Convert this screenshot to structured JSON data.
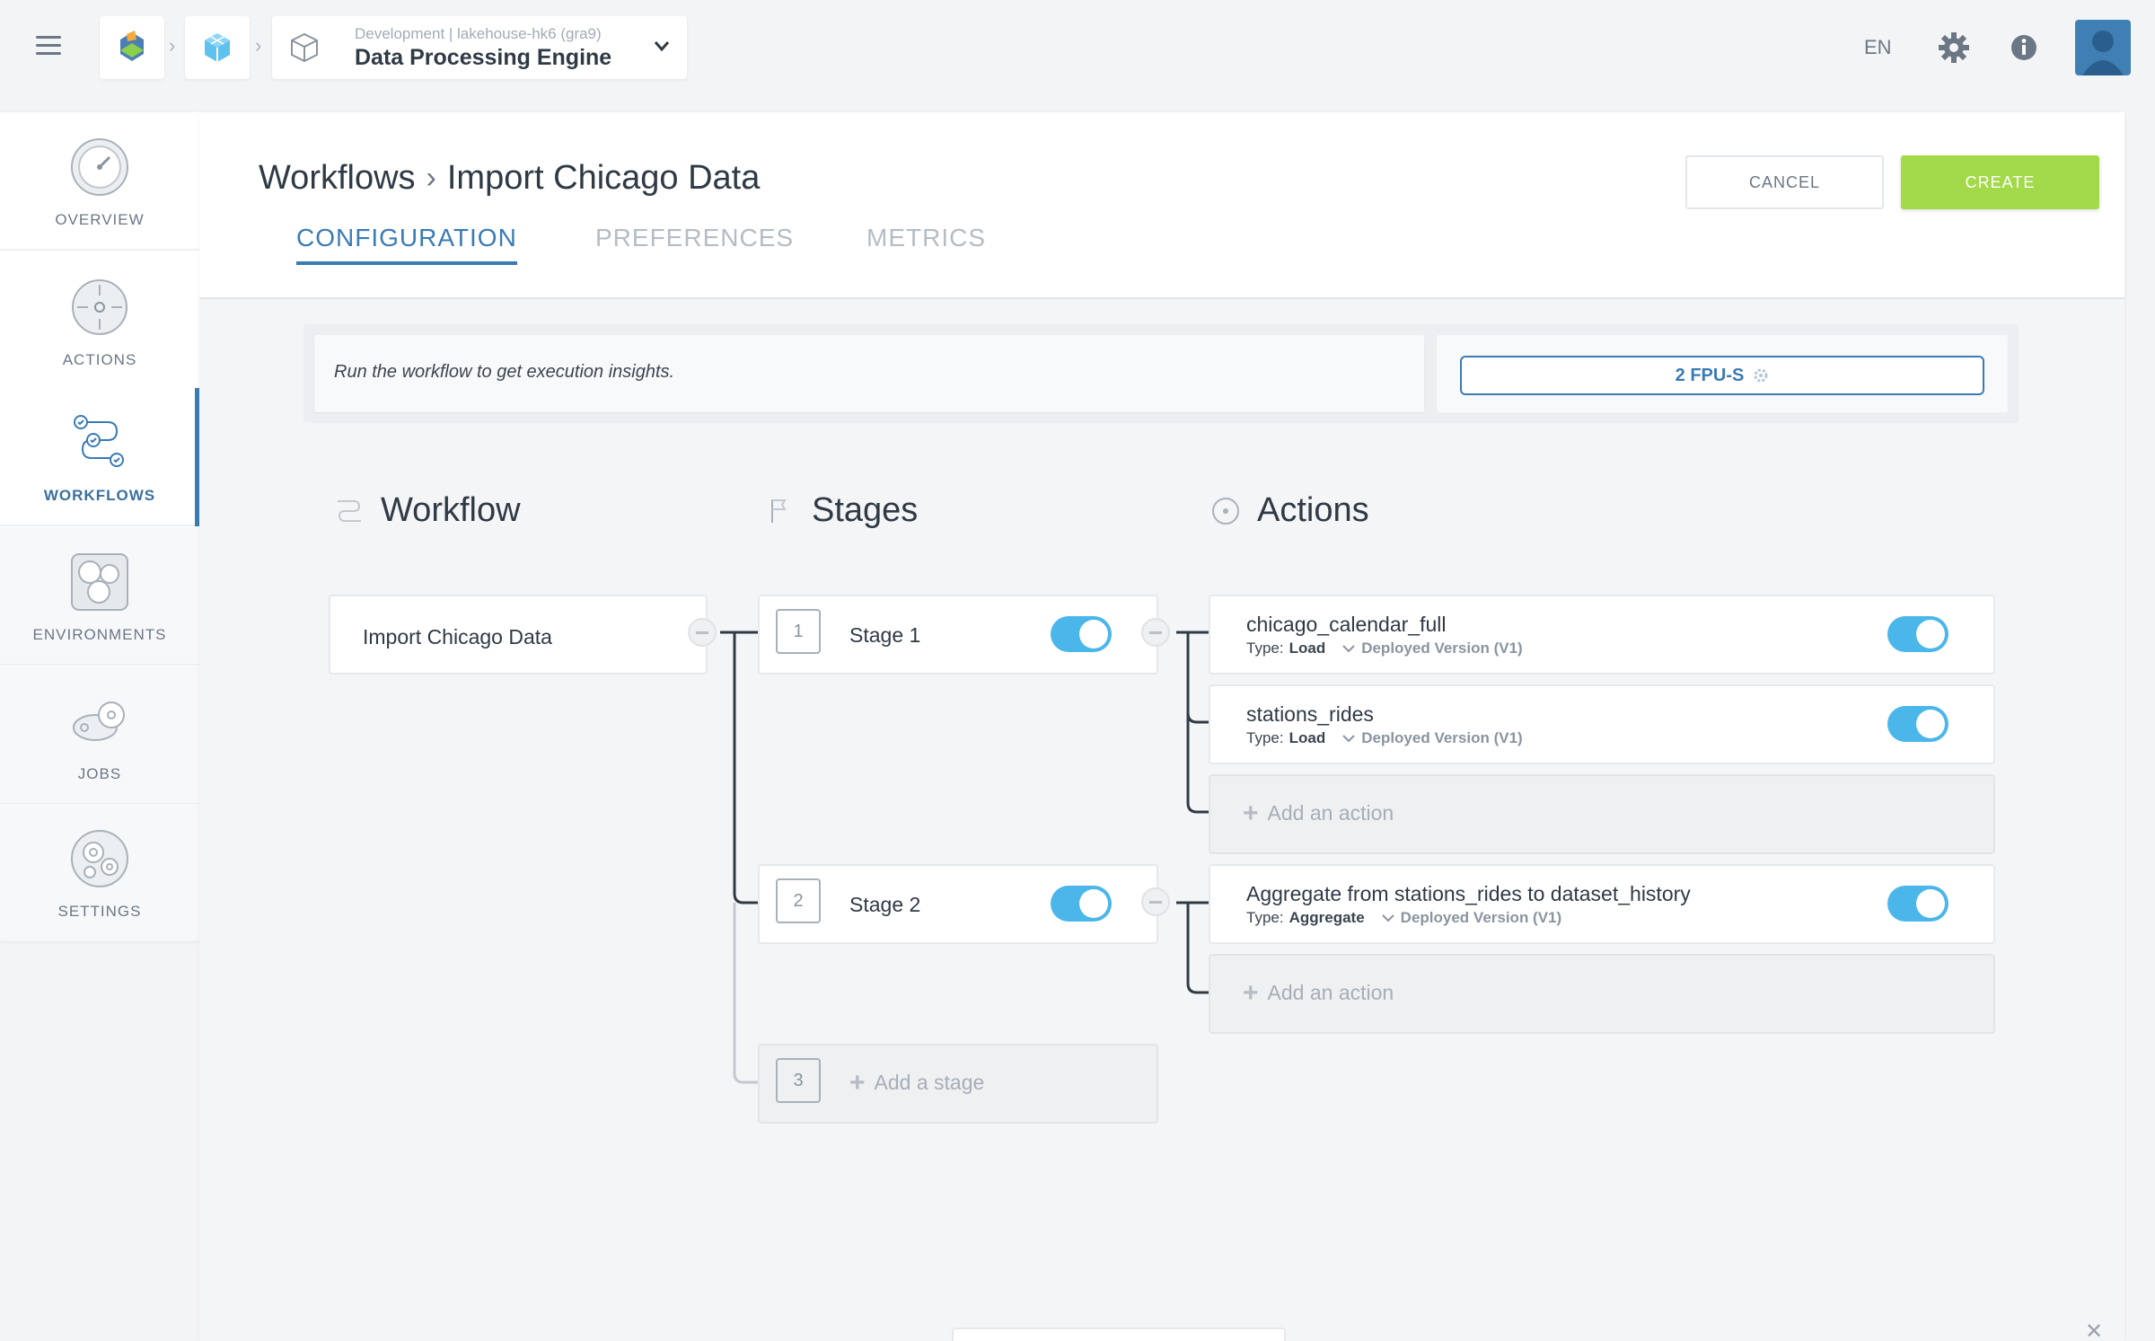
{
  "topbar": {
    "context_small": "Development | lakehouse-hk6 (gra9)",
    "context_title": "Data Processing Engine",
    "language": "EN",
    "icons": [
      "menu-icon",
      "app-logo-icon",
      "cube-icon",
      "box-icon",
      "chevron-down-icon",
      "gear-icon",
      "info-icon",
      "avatar-icon"
    ]
  },
  "sidebar": {
    "items": [
      {
        "label": "OVERVIEW",
        "icon": "speedometer-icon"
      },
      {
        "label": "ACTIONS",
        "icon": "target-icon"
      },
      {
        "label": "WORKFLOWS",
        "icon": "workflow-icon",
        "active": true
      },
      {
        "label": "ENVIRONMENTS",
        "icon": "environment-icon"
      },
      {
        "label": "JOBS",
        "icon": "jobs-icon"
      },
      {
        "label": "SETTINGS",
        "icon": "gears-icon"
      }
    ]
  },
  "header": {
    "breadcrumb_root": "Workflows",
    "breadcrumb_current": "Import Chicago Data",
    "cancel_label": "CANCEL",
    "create_label": "CREATE"
  },
  "tabs": [
    "CONFIGURATION",
    "PREFERENCES",
    "METRICS"
  ],
  "banner": {
    "message": "Run the workflow to get execution insights.",
    "fpu_label": "2 FPU-S"
  },
  "columns": {
    "workflow": "Workflow",
    "stages": "Stages",
    "actions": "Actions"
  },
  "workflow": {
    "name": "Import Chicago Data"
  },
  "stages": [
    {
      "number": "1",
      "name": "Stage 1",
      "enabled": true
    },
    {
      "number": "2",
      "name": "Stage 2",
      "enabled": true
    },
    {
      "number": "3",
      "add_label": "Add a stage"
    }
  ],
  "actions": [
    {
      "name": "chicago_calendar_full",
      "type_label": "Type:",
      "type": "Load",
      "version": "Deployed Version (V1)",
      "enabled": true
    },
    {
      "name": "stations_rides",
      "type_label": "Type:",
      "type": "Load",
      "version": "Deployed Version (V1)",
      "enabled": true
    },
    {
      "name": "Aggregate from stations_rides to dataset_history",
      "type_label": "Type:",
      "type": "Aggregate",
      "version": "Deployed Version (V1)",
      "enabled": true
    }
  ],
  "add_action_label": "Add an action",
  "colors": {
    "accent": "#3a7bb4",
    "create": "#a2da4a",
    "toggle": "#4ab6ea"
  }
}
